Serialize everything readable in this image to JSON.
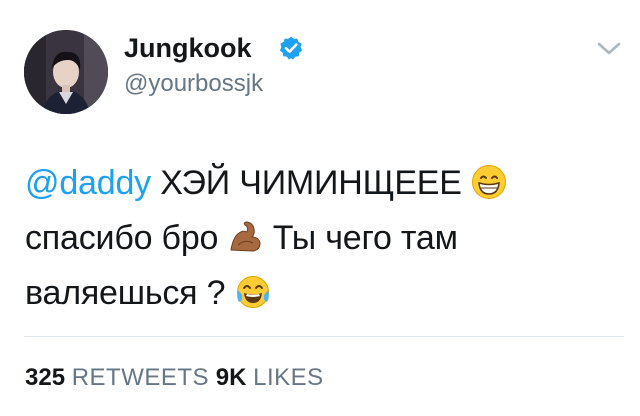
{
  "user": {
    "display_name": "Jungkook",
    "handle": "@yourbossjk",
    "verified": true
  },
  "tweet": {
    "mention": "@daddy",
    "line1_text": " ХЭЙ ЧИМИНЩЕЕЕ ",
    "line1_emoji": "grinning-face-with-smiling-eyes",
    "line2_text_a": "спасибо бро ",
    "line2_emoji": "flexed-biceps-medium-dark-skin",
    "line2_text_b": " Ты чего там",
    "line3_text": "валяешься ? ",
    "line3_emoji": "face-with-tears-of-joy"
  },
  "stats": {
    "retweets_count": "325",
    "retweets_label": "RETWEETS",
    "likes_count": "9K",
    "likes_label": "LIKES"
  },
  "colors": {
    "mention": "#1da1f2",
    "verified_badge": "#1da1f2",
    "secondary_text": "#657786",
    "divider": "#e1e8ed"
  },
  "icons": {
    "verified": "verified-badge-icon",
    "menu": "chevron-down-icon"
  }
}
